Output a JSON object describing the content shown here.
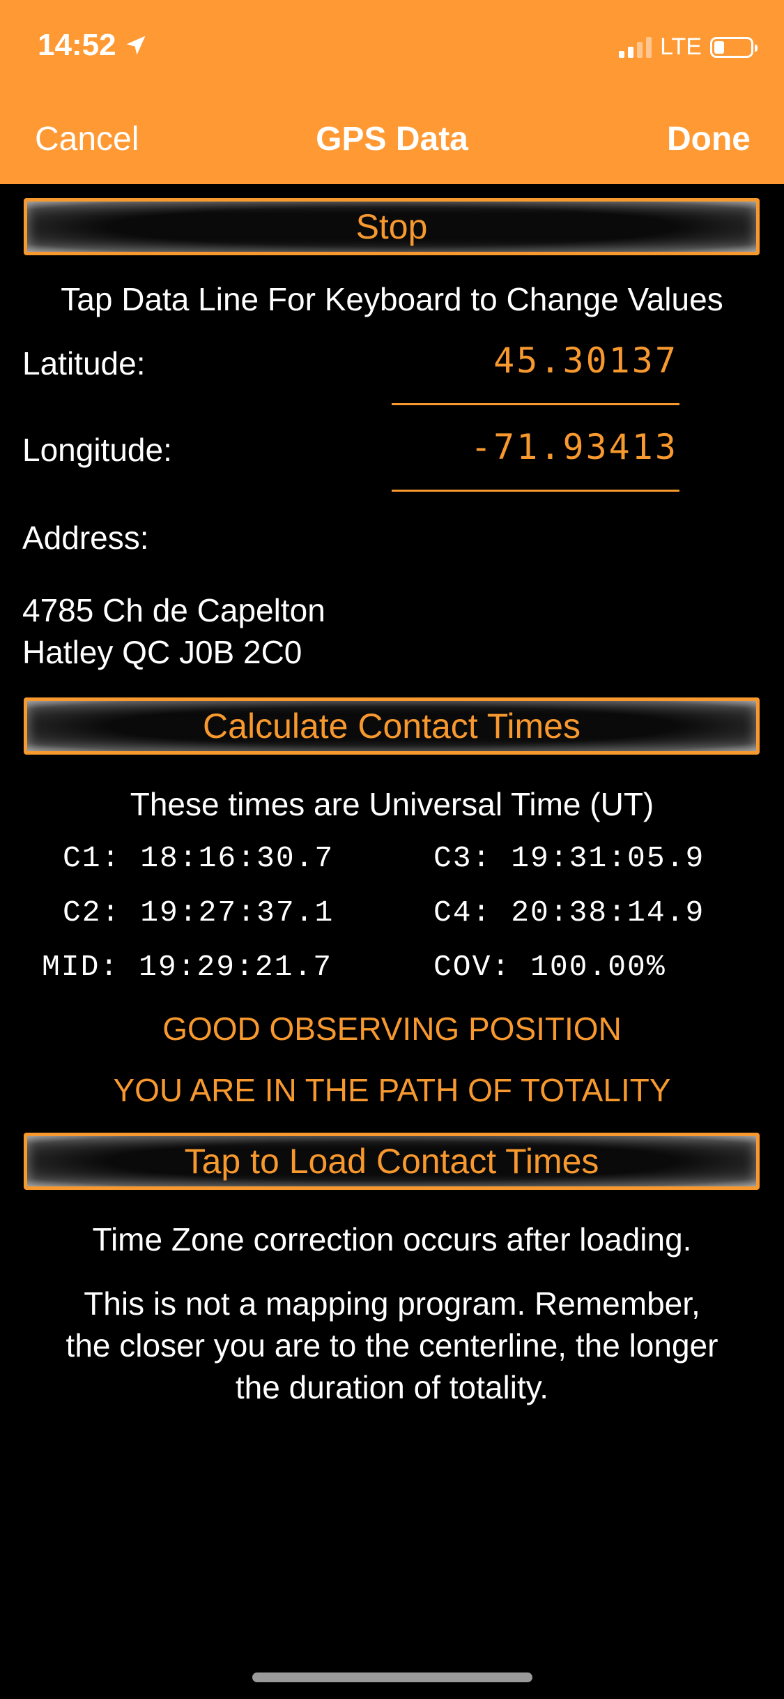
{
  "status_bar": {
    "time": "14:52",
    "network": "LTE",
    "location_icon": "location-arrow-icon"
  },
  "nav": {
    "cancel": "Cancel",
    "title": "GPS Data",
    "done": "Done"
  },
  "stop_button": "Stop",
  "instruction": "Tap Data Line For Keyboard to Change Values",
  "latitude": {
    "label": "Latitude:",
    "value": "45.30137"
  },
  "longitude": {
    "label": "Longitude:",
    "value": "-71.93413"
  },
  "address": {
    "label": "Address:",
    "line1": "4785 Ch de Capelton",
    "line2": "Hatley QC J0B 2C0"
  },
  "calculate_button": "Calculate Contact Times",
  "ut_note": "These times are Universal Time (UT)",
  "contacts": {
    "c1": "C1: 18:16:30.7",
    "c3": "C3: 19:31:05.9",
    "c2": "C2: 19:27:37.1",
    "c4": "C4: 20:38:14.9",
    "mid": "MID: 19:29:21.7",
    "cov": "COV: 100.00%"
  },
  "position_status": "GOOD OBSERVING POSITION",
  "totality_status": "YOU ARE IN THE PATH OF TOTALITY",
  "load_button": "Tap to Load Contact Times",
  "tz_note": "Time Zone correction occurs after loading.",
  "disclaimer": {
    "line1": "This is not a mapping program. Remember,",
    "line2": "the closer you are to the centerline, the longer",
    "line3": "the duration of totality."
  },
  "colors": {
    "nav_bg": "#FF9933",
    "accent": "#F7992E",
    "background": "#000000"
  }
}
